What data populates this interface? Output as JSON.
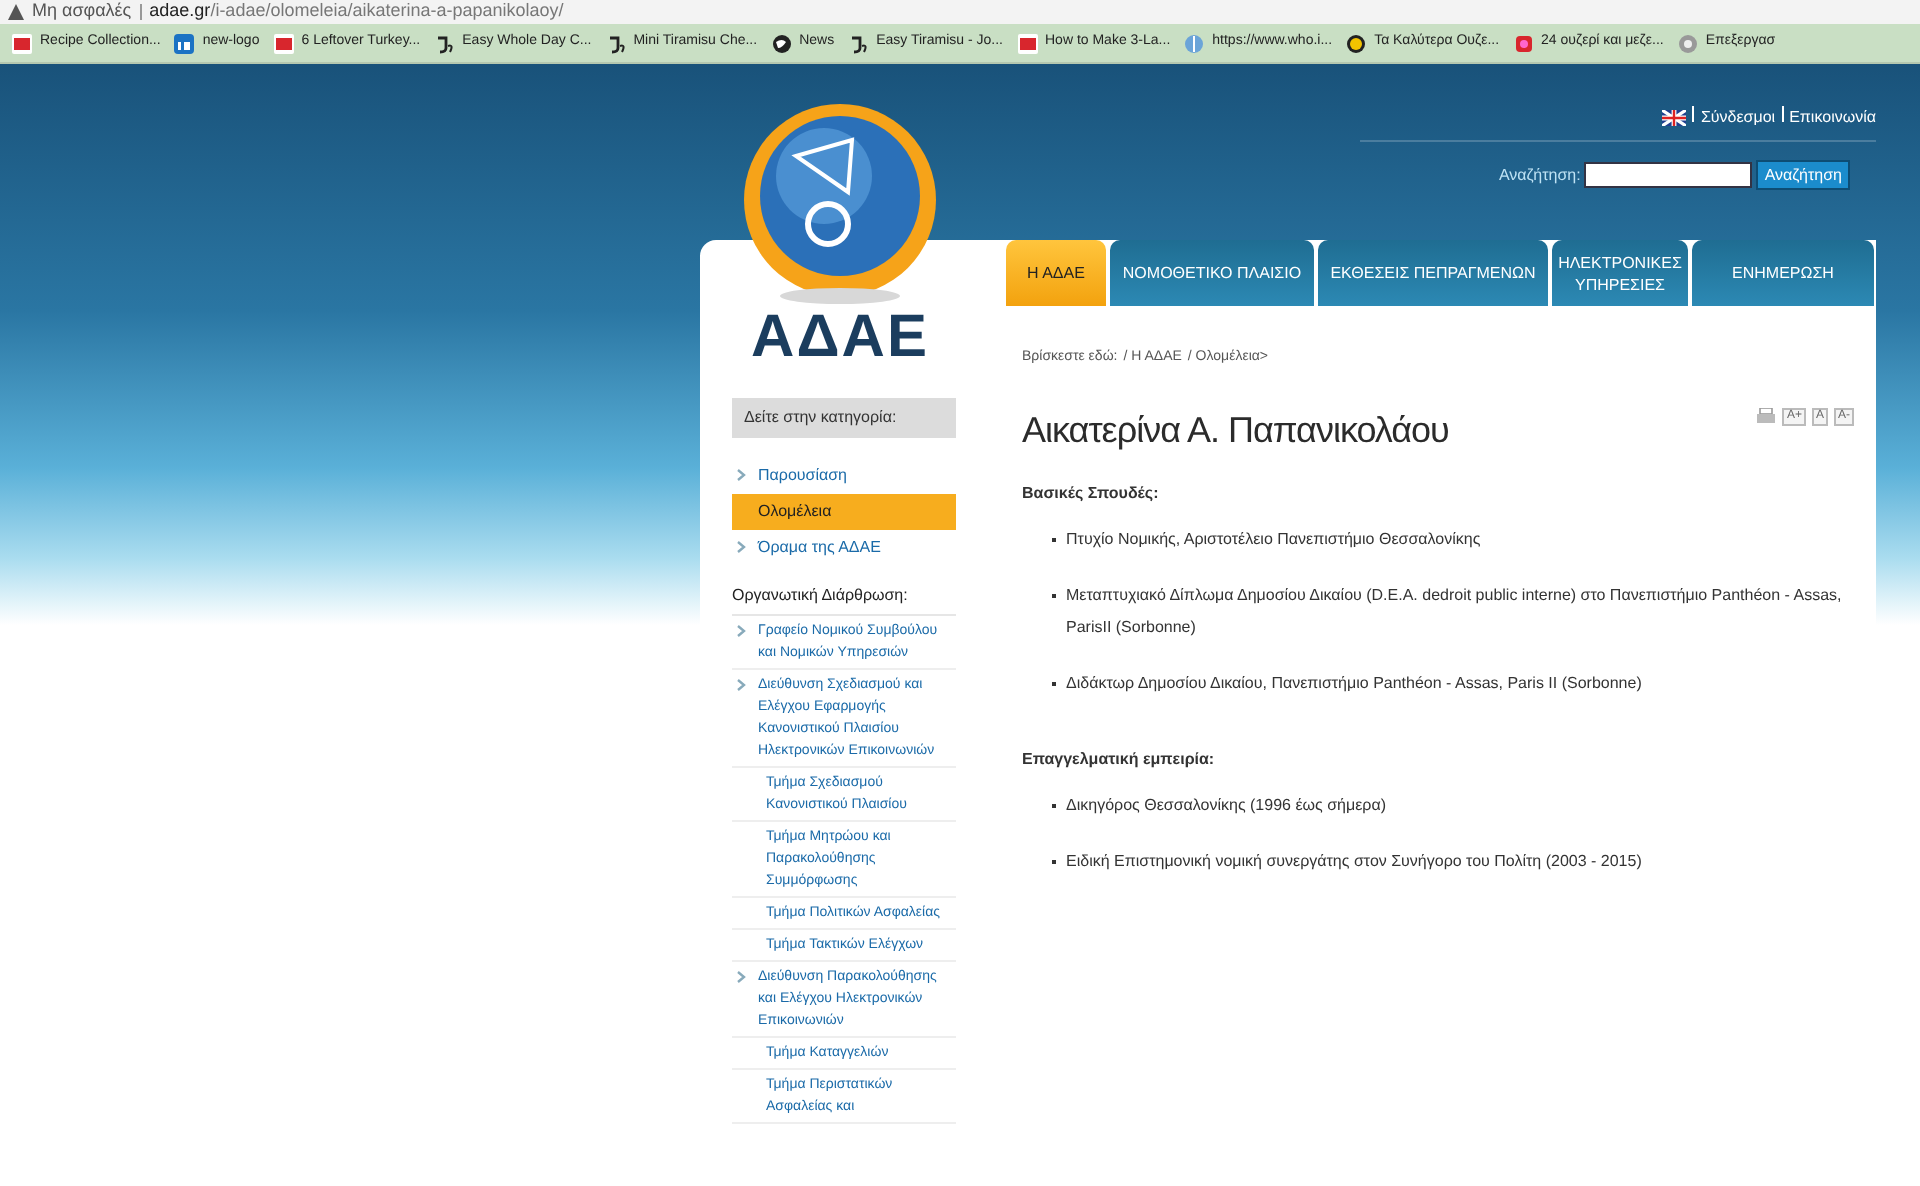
{
  "browser": {
    "security": "Μη ασφαλές",
    "url_host": "adae.gr",
    "url_path": "/i-adae/olomeleia/aikaterina-a-papanikolaoy/",
    "bookmarks": [
      {
        "kind": "rs",
        "label": "Recipe Collection..."
      },
      {
        "kind": "in",
        "label": "new-logo"
      },
      {
        "kind": "rs",
        "label": "6 Leftover Turkey..."
      },
      {
        "kind": "je",
        "label": "Easy Whole Day C..."
      },
      {
        "kind": "je",
        "label": "Mini Tiramisu Che..."
      },
      {
        "kind": "globe",
        "label": "News"
      },
      {
        "kind": "je",
        "label": "Easy Tiramisu - Jo..."
      },
      {
        "kind": "rs",
        "label": "How to Make 3-La..."
      },
      {
        "kind": "who",
        "label": "https://www.who.i..."
      },
      {
        "kind": "coin",
        "label": "Τα Καλύτερα Ουζε..."
      },
      {
        "kind": "food",
        "label": "24 ουζερί και μεζε..."
      },
      {
        "kind": "gear",
        "label": "Επεξεργασ"
      }
    ]
  },
  "header": {
    "logo_text": "ΑΔΑΕ",
    "links": [
      "Σύνδεσμοι",
      "Επικοινωνία"
    ],
    "search_label": "Αναζήτηση:",
    "search_button": "Αναζήτηση"
  },
  "tabs": [
    {
      "label": "Η ΑΔΑΕ",
      "selected": true
    },
    {
      "label": "ΝΟΜΟΘΕΤΙΚΟ ΠΛΑΙΣΙΟ",
      "selected": false
    },
    {
      "label": "ΕΚΘΕΣΕΙΣ ΠΕΠΡΑΓΜΕΝΩΝ",
      "selected": false
    },
    {
      "label": "ΗΛΕΚΤΡΟΝΙΚΕΣ ΥΠΗΡΕΣΙΕΣ",
      "selected": false
    },
    {
      "label": "ΕΝΗΜΕΡΩΣΗ",
      "selected": false
    }
  ],
  "sidebar": {
    "category_title": "Δείτε στην κατηγορία:",
    "items": [
      {
        "label": "Παρουσίαση",
        "selected": false
      },
      {
        "label": "Ολομέλεια",
        "selected": true
      },
      {
        "label": "Όραμα της ΑΔΑΕ",
        "selected": false
      }
    ],
    "section_title": "Οργανωτική Διάρθρωση:",
    "structure": [
      {
        "label": "Γραφείο Νομικού Συμβούλου και Νομικών Υπηρεσιών"
      },
      {
        "label": "Διεύθυνση Σχεδιασμού και Ελέγχου Εφαρμογής Κανονιστικού Πλαισίου Ηλεκτρονικών Επικοινωνιών",
        "children": [
          {
            "label": "Τμήμα Σχεδιασμού Κανονιστικού Πλαισίου"
          },
          {
            "label": "Τμήμα Μητρώου και Παρακολούθησης Συμμόρφωσης"
          },
          {
            "label": "Τμήμα Πολιτικών Ασφαλείας"
          },
          {
            "label": "Τμήμα Τακτικών Ελέγχων"
          }
        ]
      },
      {
        "label": "Διεύθυνση Παρακολούθησης και Ελέγχου Ηλεκτρονικών Επικοινωνιών",
        "children": [
          {
            "label": "Τμήμα Καταγγελιών"
          },
          {
            "label": "Τμήμα Περιστατικών Ασφαλείας και"
          }
        ]
      }
    ]
  },
  "breadcrumb": [
    "Βρίσκεστε εδώ:",
    "/ Η ΑΔΑΕ",
    "/ Ολομέλεια>"
  ],
  "article": {
    "title": "Αικατερίνα Α. Παπανικολάου",
    "tools": [
      "A+",
      "A",
      "A-"
    ],
    "sections": [
      {
        "heading": "Βασικές Σπουδές:",
        "items": [
          "Πτυχίο Νομικής, Αριστοτέλειο Πανεπιστήμιο Θεσσαλονίκης",
          "Μεταπτυχιακό Δίπλωμα Δημοσίου Δικαίου (D.E.A. dedroit public interne) στο Πανεπιστήμιο Panthéon - Assas, ParisII (Sorbonne)",
          "Διδάκτωρ Δημοσίου Δικαίου, Πανεπιστήμιο Panthéon - Assas, Paris II (Sorbonne)"
        ]
      },
      {
        "heading": "Επαγγελματική εμπειρία:",
        "items": [
          "Δικηγόρος Θεσσαλονίκης (1996 έως σήμερα)",
          "Ειδική Επιστημονική νομική συνεργάτης στον Συνήγορο του Πολίτη (2003 - 2015)"
        ]
      }
    ]
  }
}
